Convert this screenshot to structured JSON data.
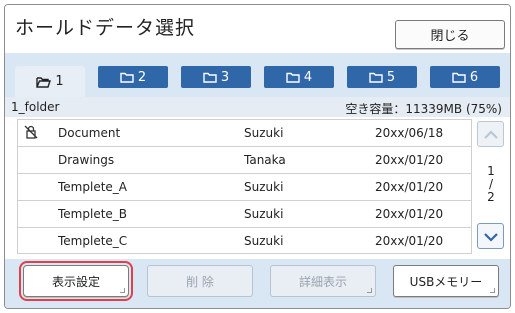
{
  "header": {
    "title": "ホールドデータ選択",
    "close_label": "閉じる"
  },
  "tabs": [
    {
      "label": "1",
      "icon": "folder-open-icon",
      "active": true
    },
    {
      "label": "2",
      "icon": "folder-icon",
      "active": false
    },
    {
      "label": "3",
      "icon": "folder-icon",
      "active": false
    },
    {
      "label": "4",
      "icon": "folder-icon",
      "active": false
    },
    {
      "label": "5",
      "icon": "folder-icon",
      "active": false
    },
    {
      "label": "6",
      "icon": "folder-icon",
      "active": false
    }
  ],
  "info": {
    "folder_name": "1_folder",
    "free_space": "空き容量：11339MB (75%)"
  },
  "files": [
    {
      "name": "Document",
      "owner": "Suzuki",
      "date": "20xx/06/18",
      "locked": true
    },
    {
      "name": "Drawings",
      "owner": "Tanaka",
      "date": "20xx/01/20",
      "locked": false
    },
    {
      "name": "Templete_A",
      "owner": "Suzuki",
      "date": "20xx/01/20",
      "locked": false
    },
    {
      "name": "Templete_B",
      "owner": "Suzuki",
      "date": "20xx/01/20",
      "locked": false
    },
    {
      "name": "Templete_C",
      "owner": "Suzuki",
      "date": "20xx/01/20",
      "locked": false
    }
  ],
  "pagination": {
    "current": "1",
    "separator": "/",
    "total": "2"
  },
  "footer": {
    "display_settings": "表示設定",
    "delete": "削 除",
    "details": "詳細表示",
    "usb_memory": "USBメモリー"
  },
  "colors": {
    "tab_blue": "#2f67a8",
    "strip_bg": "#d9e6f3",
    "highlight_ring": "#e0404a"
  }
}
